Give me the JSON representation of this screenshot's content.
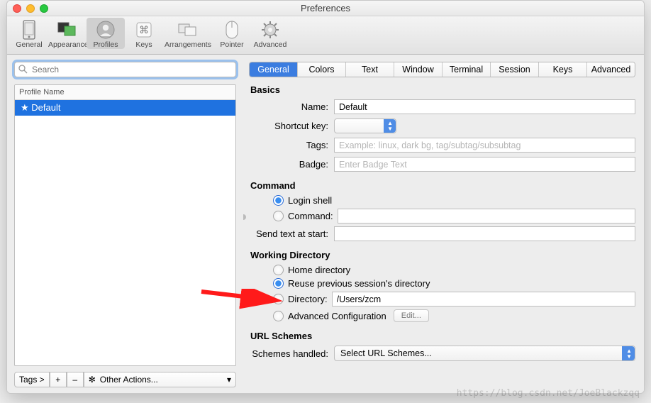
{
  "window": {
    "title": "Preferences"
  },
  "toolbar": {
    "items": [
      {
        "label": "General"
      },
      {
        "label": "Appearance"
      },
      {
        "label": "Profiles"
      },
      {
        "label": "Keys"
      },
      {
        "label": "Arrangements"
      },
      {
        "label": "Pointer"
      },
      {
        "label": "Advanced"
      }
    ],
    "selected_label": "Profiles"
  },
  "sidebar": {
    "search_placeholder": "Search",
    "column_header": "Profile Name",
    "items": [
      {
        "label": "★ Default"
      }
    ],
    "tags_label": "Tags >",
    "plus": "+",
    "minus": "–",
    "other_actions_label": "Other Actions..."
  },
  "tabs": [
    "General",
    "Colors",
    "Text",
    "Window",
    "Terminal",
    "Session",
    "Keys",
    "Advanced"
  ],
  "active_tab": "General",
  "sections": {
    "basics": {
      "title": "Basics",
      "name_label": "Name:",
      "name_value": "Default",
      "shortcut_label": "Shortcut key:",
      "tags_label": "Tags:",
      "tags_placeholder": "Example: linux, dark bg, tag/subtag/subsubtag",
      "badge_label": "Badge:",
      "badge_placeholder": "Enter Badge Text"
    },
    "command": {
      "title": "Command",
      "login_shell_label": "Login shell",
      "command_label": "Command:",
      "send_text_label": "Send text at start:"
    },
    "working_dir": {
      "title": "Working Directory",
      "home_label": "Home directory",
      "reuse_label": "Reuse previous session's directory",
      "directory_label": "Directory:",
      "directory_value": "/Users/zcm",
      "advanced_label": "Advanced Configuration",
      "edit_label": "Edit..."
    },
    "url_schemes": {
      "title": "URL Schemes",
      "handled_label": "Schemes handled:",
      "select_placeholder": "Select URL Schemes..."
    }
  },
  "watermark": "https://blog.csdn.net/JoeBlackzqq"
}
